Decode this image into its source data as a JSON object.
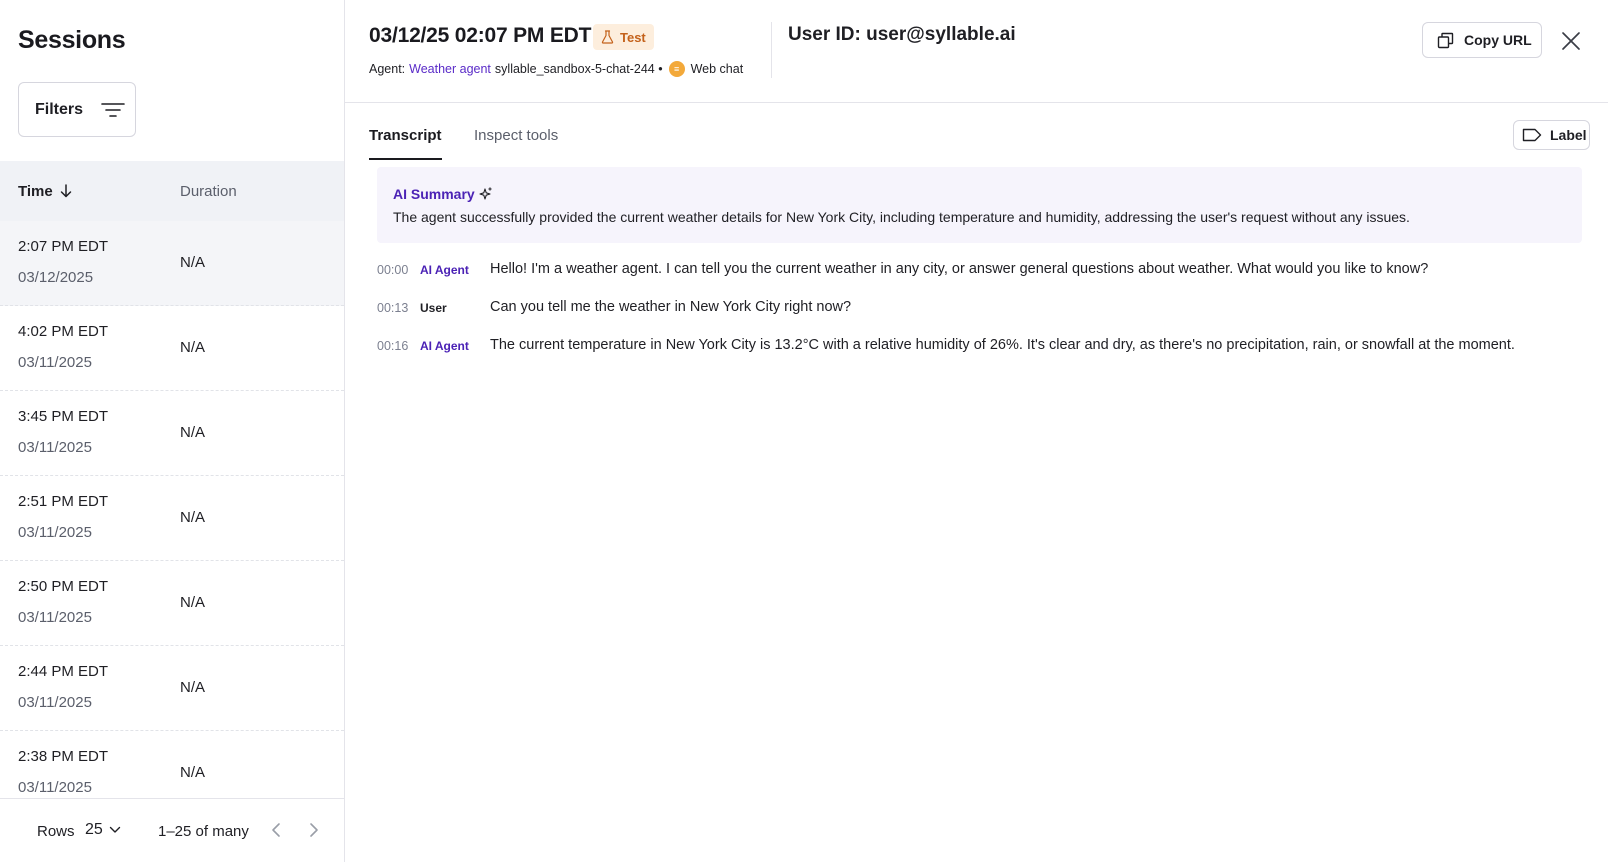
{
  "sidebar": {
    "title": "Sessions",
    "filters_label": "Filters",
    "columns": {
      "time": "Time",
      "duration": "Duration"
    },
    "rows": [
      {
        "time": "2:07 PM EDT",
        "date": "03/12/2025",
        "duration": "N/A"
      },
      {
        "time": "4:02 PM EDT",
        "date": "03/11/2025",
        "duration": "N/A"
      },
      {
        "time": "3:45 PM EDT",
        "date": "03/11/2025",
        "duration": "N/A"
      },
      {
        "time": "2:51 PM EDT",
        "date": "03/11/2025",
        "duration": "N/A"
      },
      {
        "time": "2:50 PM EDT",
        "date": "03/11/2025",
        "duration": "N/A"
      },
      {
        "time": "2:44 PM EDT",
        "date": "03/11/2025",
        "duration": "N/A"
      },
      {
        "time": "2:38 PM EDT",
        "date": "03/11/2025",
        "duration": "N/A"
      }
    ],
    "pager": {
      "rows_label": "Rows",
      "rows_value": "25",
      "range": "1–25 of many"
    }
  },
  "detail": {
    "title": "03/12/25 02:07 PM EDT",
    "badge": "Test",
    "agent_label": "Agent:",
    "agent_name": "Weather agent",
    "agent_id": "syllable_sandbox-5-chat-244 •",
    "channel": "Web chat",
    "user_id": "User ID: user@syllable.ai",
    "copy_url_label": "Copy URL"
  },
  "tabs": {
    "transcript": "Transcript",
    "inspect": "Inspect tools",
    "label_button": "Label"
  },
  "summary": {
    "title": "AI Summary",
    "text": "The agent successfully provided the current weather details for New York City, including temperature and humidity, addressing the user's request without any issues."
  },
  "transcript": [
    {
      "ts": "00:00",
      "speaker": "AI Agent",
      "text": "Hello! I'm a weather agent. I can tell you the current weather in any city, or answer general questions about weather. What would you like to know?"
    },
    {
      "ts": "00:13",
      "speaker": "User",
      "text": "Can you tell me the weather in New York City right now?"
    },
    {
      "ts": "00:16",
      "speaker": "AI Agent",
      "text": "The current temperature in New York City is 13.2°C with a relative humidity of 26%. It's clear and dry, as there's no precipitation, rain, or snowfall at the moment."
    }
  ],
  "colors": {
    "accent": "#4b22b5",
    "agent_link": "#5a2bc8",
    "badge_bg": "#fdeedd",
    "badge_fg": "#c4621b",
    "summary_bg": "#f6f4fc"
  }
}
